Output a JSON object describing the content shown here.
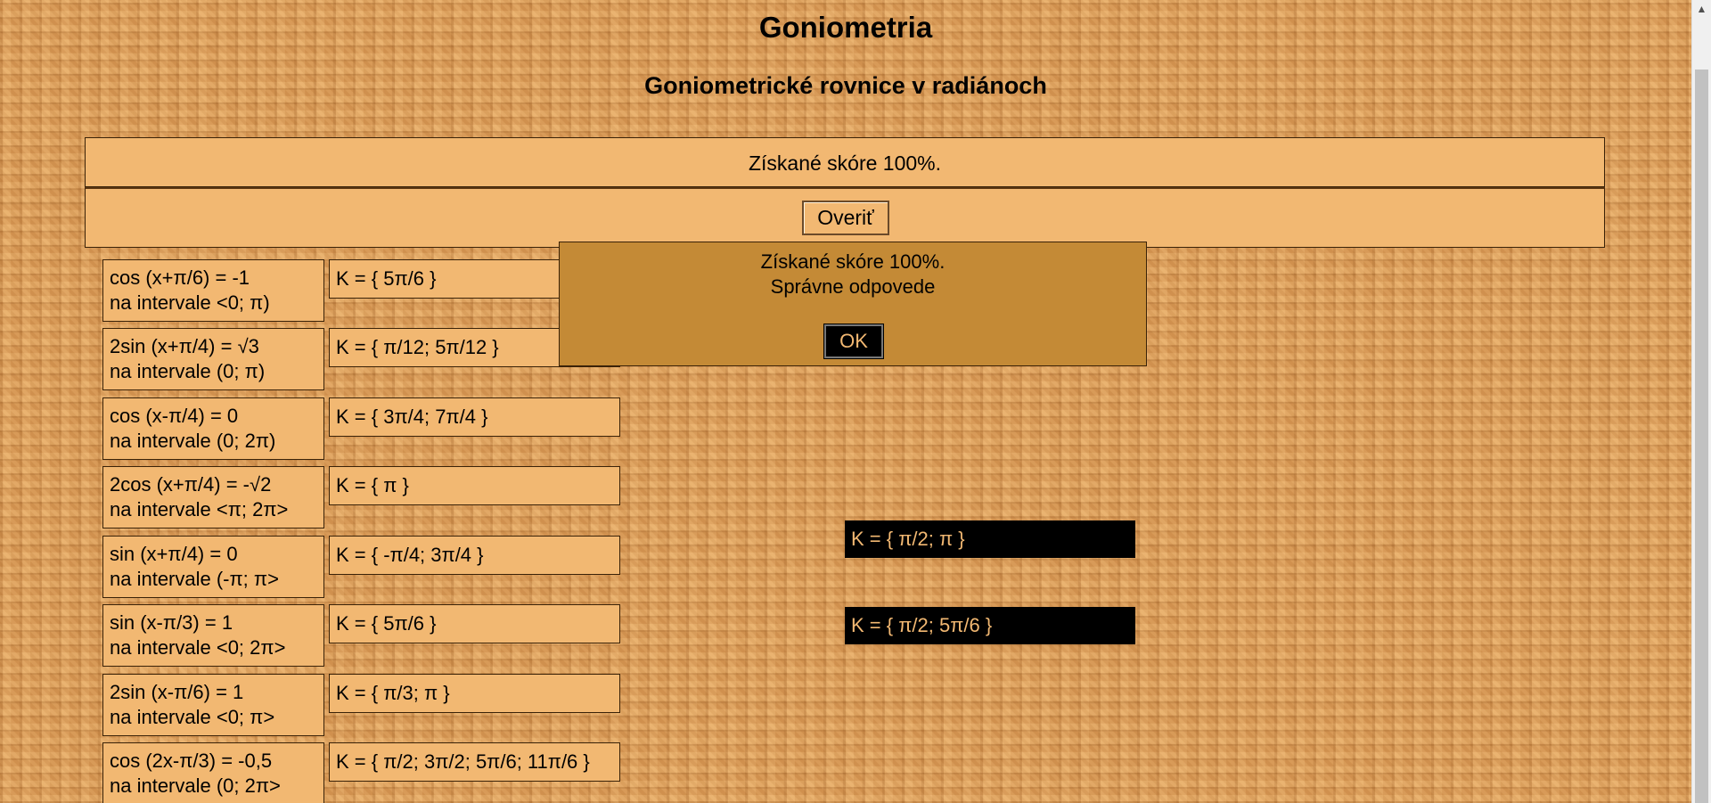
{
  "page": {
    "title": "Goniometria",
    "subtitle": "Goniometrické rovnice v radiánoch"
  },
  "score": {
    "text": "Získané skóre 100%."
  },
  "toolbar": {
    "verify_label": "Overiť"
  },
  "equations": [
    {
      "line1": "cos (x+π/6) = -1",
      "line2": "na intervale <0; π)",
      "answer": "K = { 5π/6 }"
    },
    {
      "line1": "2sin (x+π/4) = √3",
      "line2": "na intervale (0; π)",
      "answer": "K = { π/12; 5π/12 }"
    },
    {
      "line1": "cos (x-π/4) = 0",
      "line2": "na intervale (0; 2π)",
      "answer": "K = { 3π/4; 7π/4 }"
    },
    {
      "line1": "2cos (x+π/4) = -√2",
      "line2": "na intervale <π; 2π>",
      "answer": "K = { π }"
    },
    {
      "line1": "sin (x+π/4) = 0",
      "line2": "na intervale (-π; π>",
      "answer": "K = { -π/4; 3π/4 }"
    },
    {
      "line1": "sin (x-π/3) = 1",
      "line2": "na intervale <0; 2π>",
      "answer": "K = { 5π/6 }"
    },
    {
      "line1": "2sin (x-π/6) = 1",
      "line2": "na intervale <0; π>",
      "answer": "K = { π/3; π }"
    },
    {
      "line1": "cos (2x-π/3) = -0,5",
      "line2": "na intervale (0; 2π>",
      "answer": "K = { π/2; 3π/2; 5π/6; 11π/6 }"
    }
  ],
  "alternatives": [
    {
      "text": "K = { π/2; π }"
    },
    {
      "text": "K = { π/2; 5π/6 }"
    }
  ],
  "dialog": {
    "line1": "Získané skóre 100%.",
    "line2": "Správne odpovede",
    "ok_label": "OK"
  },
  "scrollbar": {
    "up_icon": "triangle-up-icon"
  }
}
